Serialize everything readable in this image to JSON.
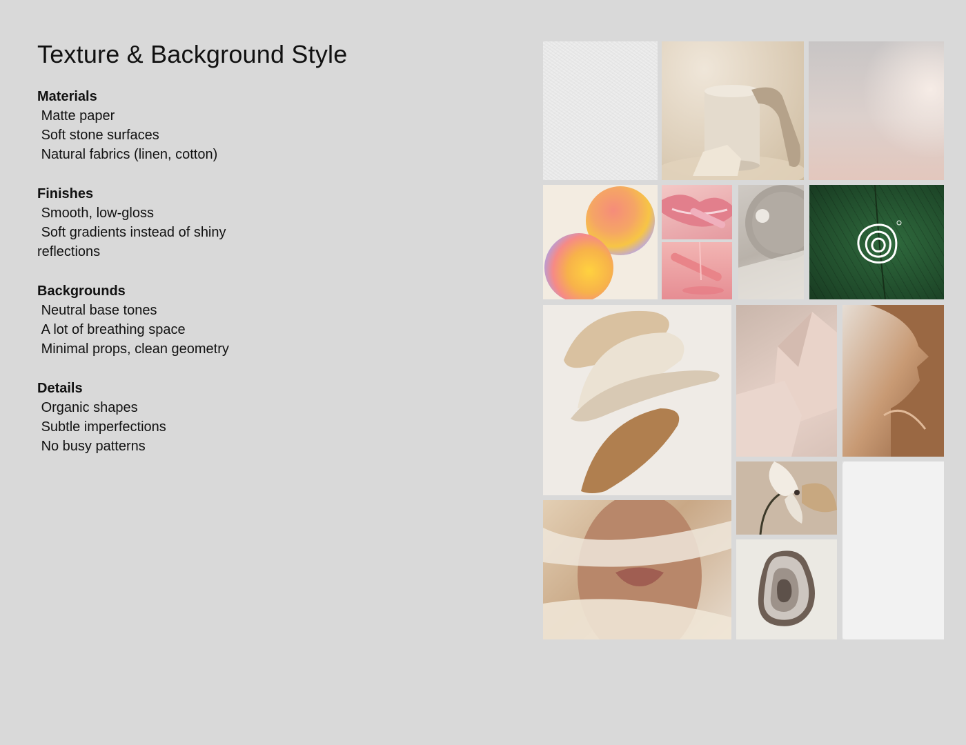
{
  "title": "Texture & Background Style",
  "sections": [
    {
      "heading": "Materials",
      "body": " Matte paper\n Soft stone surfaces\n Natural fabrics (linen, cotton)"
    },
    {
      "heading": "Finishes",
      "body": " Smooth, low-gloss\n Soft gradients instead of shiny\nreflections"
    },
    {
      "heading": "Backgrounds",
      "body": " Neutral base tones\n A lot of breathing space\n Minimal props, clean geometry"
    },
    {
      "heading": "Details",
      "body": " Organic shapes\n Subtle imperfections\n No busy patterns"
    }
  ],
  "colors": {
    "background": "#d9d9d9",
    "text": "#111111"
  }
}
